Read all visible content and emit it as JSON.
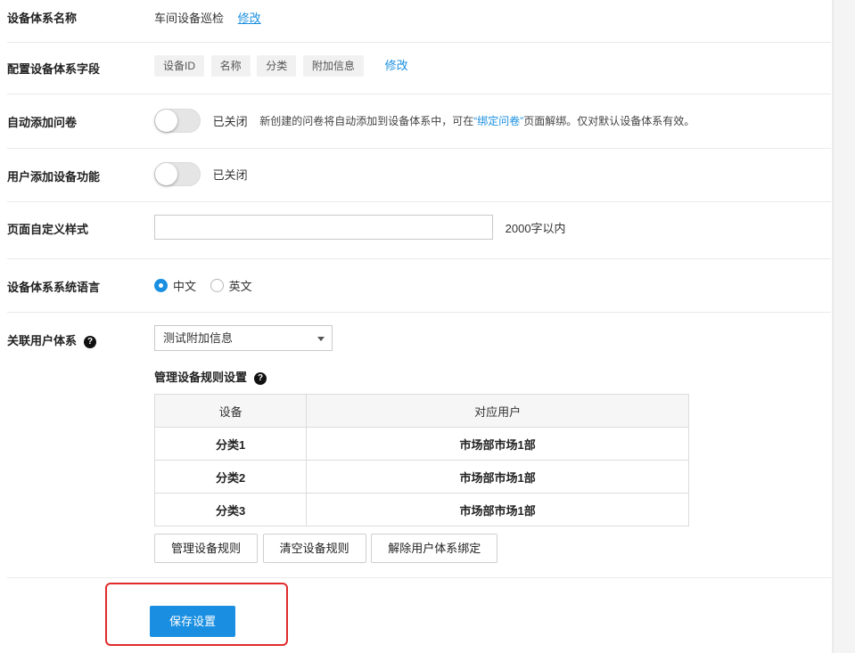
{
  "name_row": {
    "label": "设备体系名称",
    "value": "车间设备巡检",
    "edit": "修改"
  },
  "fields_row": {
    "label": "配置设备体系字段",
    "tags": [
      "设备ID",
      "名称",
      "分类",
      "附加信息"
    ],
    "edit": "修改"
  },
  "auto_row": {
    "label": "自动添加问卷",
    "state": "已关闭",
    "hint_prefix": "新创建的问卷将自动添加到设备体系中，可在",
    "hint_link": "“绑定问卷”",
    "hint_suffix": "页面解绑。仅对默认设备体系有效。"
  },
  "user_add_row": {
    "label": "用户添加设备功能",
    "state": "已关闭"
  },
  "style_row": {
    "label": "页面自定义样式",
    "value": "",
    "suffix": "2000字以内"
  },
  "lang_row": {
    "label": "设备体系系统语言",
    "options": [
      "中文",
      "英文"
    ],
    "selected": "中文"
  },
  "link_row": {
    "label": "关联用户体系",
    "help": "?",
    "selected": "测试附加信息",
    "sub_title": "管理设备规则设置",
    "table": {
      "headers": [
        "设备",
        "对应用户"
      ],
      "rows": [
        [
          "分类1",
          "市场部市场1部"
        ],
        [
          "分类2",
          "市场部市场1部"
        ],
        [
          "分类3",
          "市场部市场1部"
        ]
      ]
    },
    "buttons": [
      "管理设备规则",
      "清空设备规则",
      "解除用户体系绑定"
    ]
  },
  "save_label": "保存设置",
  "colors": {
    "accent": "#1a8fe1",
    "highlight": "#e02b2b"
  }
}
